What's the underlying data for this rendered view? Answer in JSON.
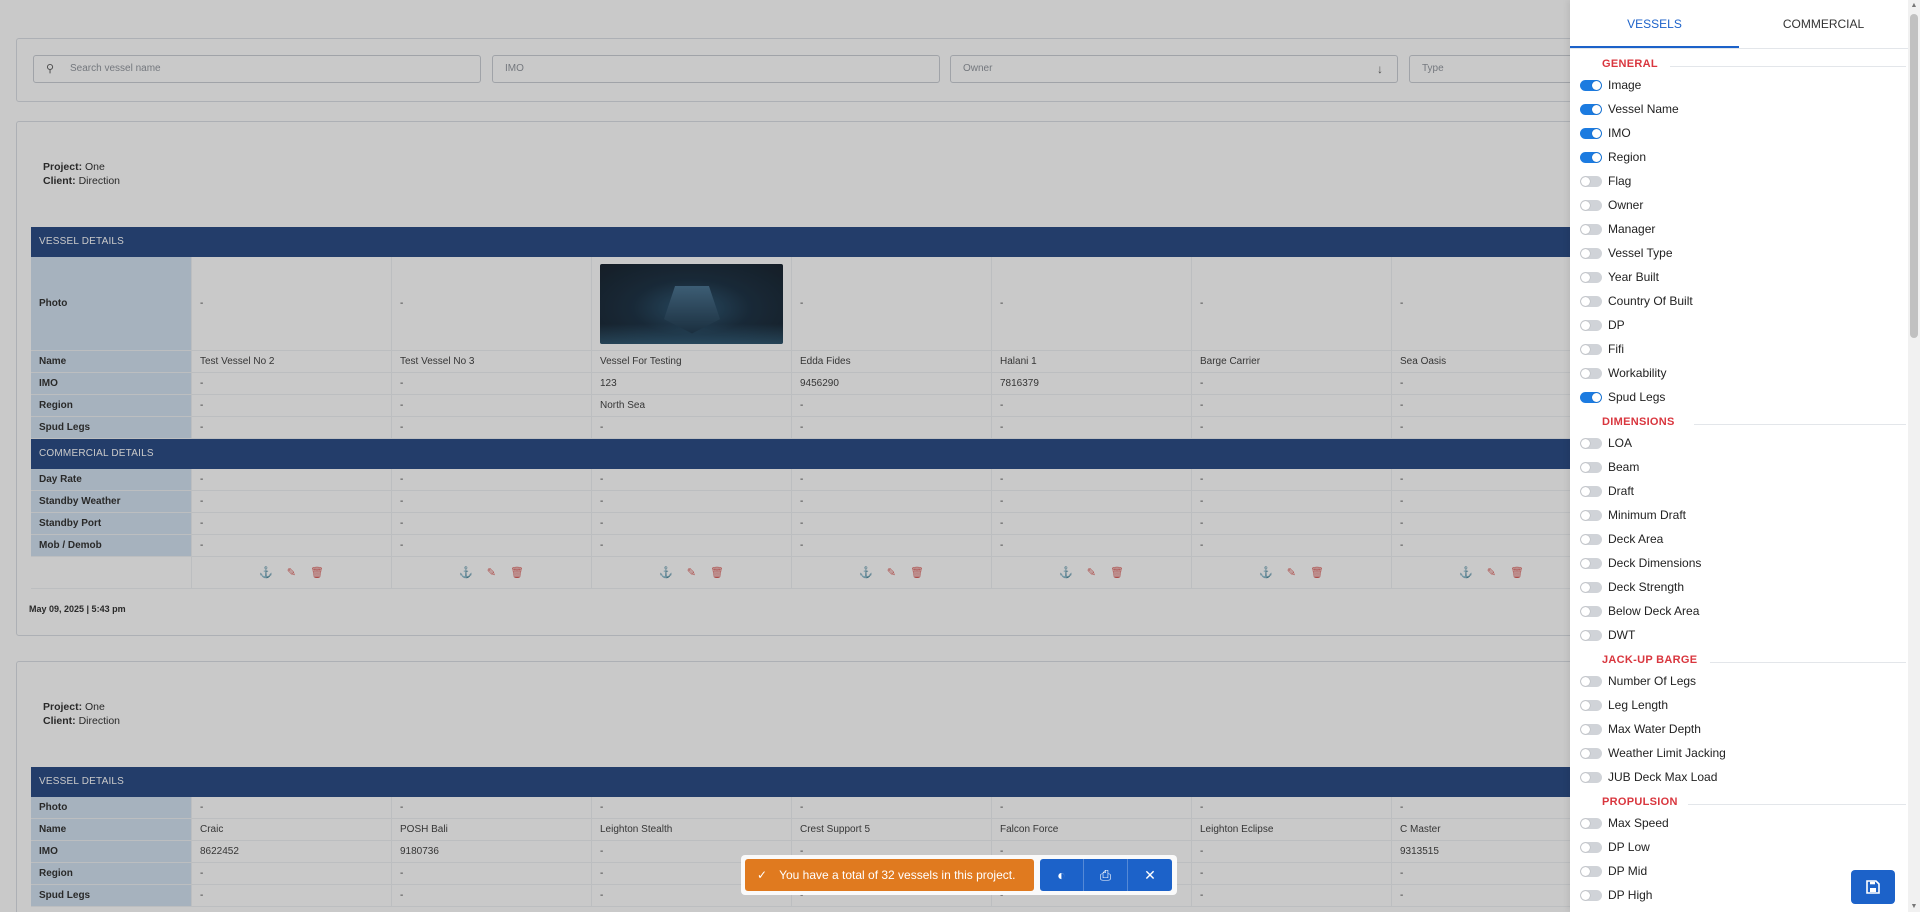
{
  "filters": {
    "search_placeholder": "Search vessel name",
    "imo_placeholder": "IMO",
    "owner_placeholder": "Owner",
    "type_placeholder": "Type"
  },
  "card1": {
    "project_label": "Project:",
    "project_value": "One",
    "client_label": "Client:",
    "client_value": "Direction",
    "vessel_details_title": "VESSEL DETAILS",
    "commercial_details_title": "COMMERCIAL DETAILS",
    "labels": {
      "photo": "Photo",
      "name": "Name",
      "imo": "IMO",
      "region": "Region",
      "spud_legs": "Spud Legs",
      "day_rate": "Day Rate",
      "standby_weather": "Standby Weather",
      "standby_port": "Standby Port",
      "mob_demob": "Mob / Demob"
    },
    "names": [
      "Test Vessel No 2",
      "Test Vessel No 3",
      "Vessel For Testing",
      "Edda Fides",
      "Halani 1",
      "Barge Carrier",
      "Sea Oasis"
    ],
    "photos": [
      "-",
      "-",
      "",
      "-",
      "-",
      "-",
      "-"
    ],
    "imos": [
      "-",
      "-",
      "123",
      "9456290",
      "7816379",
      "-",
      "-"
    ],
    "regions": [
      "-",
      "-",
      "North Sea",
      "-",
      "-",
      "-",
      "-"
    ],
    "spud_legs": [
      "-",
      "-",
      "-",
      "-",
      "-",
      "-",
      "-"
    ],
    "day_rate": [
      "-",
      "-",
      "-",
      "-",
      "-",
      "-",
      "-"
    ],
    "standby_weather": [
      "-",
      "-",
      "-",
      "-",
      "-",
      "-",
      "-"
    ],
    "standby_port": [
      "-",
      "-",
      "-",
      "-",
      "-",
      "-",
      "-"
    ],
    "mob_demob": [
      "-",
      "-",
      "-",
      "-",
      "-",
      "-",
      "-"
    ],
    "timestamp": "May 09, 2025 | 5:43 pm"
  },
  "card2": {
    "project_label": "Project:",
    "project_value": "One",
    "client_label": "Client:",
    "client_value": "Direction",
    "vessel_details_title": "VESSEL DETAILS",
    "names": [
      "Craic",
      "POSH Bali",
      "Leighton Stealth",
      "Crest Support 5",
      "Falcon Force",
      "Leighton Eclipse",
      "C Master"
    ],
    "photos": [
      "-",
      "-",
      "-",
      "-",
      "-",
      "-",
      "-"
    ],
    "imos": [
      "8622452",
      "9180736",
      "-",
      "-",
      "-",
      "-",
      "9313515"
    ],
    "regions": [
      "-",
      "-",
      "-",
      "-",
      "-",
      "-",
      "-"
    ],
    "spud_legs": [
      "-",
      "-",
      "-",
      "-",
      "-",
      "-",
      "-"
    ]
  },
  "toast": {
    "message": "You have a total of 32 vessels in this project."
  },
  "panel": {
    "tabs": [
      "VESSELS",
      "COMMERCIAL"
    ],
    "groups": [
      {
        "title": "GENERAL",
        "options": [
          {
            "label": "Image",
            "on": true
          },
          {
            "label": "Vessel Name",
            "on": true
          },
          {
            "label": "IMO",
            "on": true
          },
          {
            "label": "Region",
            "on": true
          },
          {
            "label": "Flag",
            "on": false
          },
          {
            "label": "Owner",
            "on": false
          },
          {
            "label": "Manager",
            "on": false
          },
          {
            "label": "Vessel Type",
            "on": false
          },
          {
            "label": "Year Built",
            "on": false
          },
          {
            "label": "Country Of Built",
            "on": false
          },
          {
            "label": "DP",
            "on": false
          },
          {
            "label": "Fifi",
            "on": false
          },
          {
            "label": "Workability",
            "on": false
          },
          {
            "label": "Spud Legs",
            "on": true
          }
        ]
      },
      {
        "title": "DIMENSIONS",
        "options": [
          {
            "label": "LOA",
            "on": false
          },
          {
            "label": "Beam",
            "on": false
          },
          {
            "label": "Draft",
            "on": false
          },
          {
            "label": "Minimum Draft",
            "on": false
          },
          {
            "label": "Deck Area",
            "on": false
          },
          {
            "label": "Deck Dimensions",
            "on": false
          },
          {
            "label": "Deck Strength",
            "on": false
          },
          {
            "label": "Below Deck Area",
            "on": false
          },
          {
            "label": "DWT",
            "on": false
          }
        ]
      },
      {
        "title": "JACK-UP BARGE",
        "options": [
          {
            "label": "Number Of Legs",
            "on": false
          },
          {
            "label": "Leg Length",
            "on": false
          },
          {
            "label": "Max Water Depth",
            "on": false
          },
          {
            "label": "Weather Limit Jacking",
            "on": false
          },
          {
            "label": "JUB Deck Max Load",
            "on": false
          }
        ]
      },
      {
        "title": "PROPULSION",
        "options": [
          {
            "label": "Max Speed",
            "on": false
          },
          {
            "label": "DP Low",
            "on": false
          },
          {
            "label": "DP Mid",
            "on": false
          },
          {
            "label": "DP High",
            "on": false
          }
        ]
      }
    ]
  },
  "colors": {
    "accent": "#1c62c9",
    "section_bar": "#1a3d7c",
    "group_title": "#d9363e",
    "toast": "#e07a1f",
    "label_cell": "#cfe0f0"
  },
  "icons": [
    "search-icon",
    "chevron-down-icon",
    "ship-icon",
    "edit-icon",
    "trash-icon",
    "check-circle-icon",
    "toggle-icon",
    "print-icon",
    "close-icon",
    "save-icon"
  ]
}
